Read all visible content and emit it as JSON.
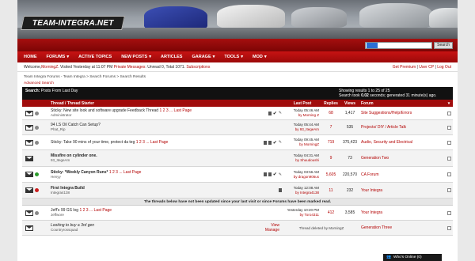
{
  "logo": {
    "text": "TEAM-INTEGRA.NET"
  },
  "search": {
    "placeholder": "",
    "button": "Search"
  },
  "nav": [
    "HOME",
    "FORUMS",
    "ACTIVE TOPICS",
    "NEW POSTS",
    "ARTICLES",
    "GARAGE",
    "TOOLS",
    "MOD"
  ],
  "userbar": {
    "welcome": "Welcome, ",
    "user": "MorningZ",
    "visited": ". Visited Yesterday at 11:07 PM",
    "pm": "Private Messages",
    "pm_counts": ": Unread 0, Total 1071.",
    "subs": "Subscriptions",
    "right": [
      "Get Premium",
      "User CP",
      "Log Out"
    ]
  },
  "breadcrumb": "Team Integra Forums - Team Integra > Search Forums > Search Results",
  "adv_search": "Advanced Search",
  "results": {
    "label": "Search:",
    "query": "Posts From Last Day",
    "showing": "Showing results 1 to 25 of 25",
    "took_prefix": "Search took ",
    "took_value": "0.02",
    "took_suffix": " seconds; generated 31 minute(s) ago."
  },
  "columns": {
    "title": "Thread / Thread Starter",
    "last": "Last Post",
    "replies": "Replies",
    "views": "Views",
    "forum": "Forum"
  },
  "rows": [
    {
      "title": "Sticky: New site look and software upgrade Feedback Thread",
      "pages": "1 2 3 ... Last Page",
      "starter": "Administrator",
      "last_time": "Today 05:46 AM",
      "last_by": "by Morning Z",
      "replies": "68",
      "views": "1,417",
      "forum": "Site Suggestions/Help/Errors",
      "style": "normal"
    },
    {
      "title": "94 LS Oil Catch Can Setup?",
      "pages": "",
      "starter": "Phat_Rip",
      "last_time": "Today 05:44 AM",
      "last_by": "by 93_ItegeAm",
      "replies": "7",
      "views": "535",
      "forum": "Projects/ DIY / Article Talk",
      "style": "normal"
    },
    {
      "title": "Sticky: Take 90 mins of your time, protect da teg",
      "pages": "1 2 3 ... Last Page",
      "starter": "",
      "last_time": "Today 09:45 AM",
      "last_by": "by MorningZ",
      "replies": "719",
      "views": "375,423",
      "forum": "Audio, Security and Electrical",
      "style": "normal"
    },
    {
      "title": "Missfire on cylinder one.",
      "pages": "",
      "starter": "93_ItegeAm",
      "last_time": "Today 04:31 AM",
      "last_by": "by Shuudoushi",
      "replies": "9",
      "views": "73",
      "forum": "Generation Two",
      "style": "bold"
    },
    {
      "title": "Sticky: *Weekly Canyon Runs*",
      "pages": "1 2 3 ... Last Page",
      "starter": "Henyy",
      "last_time": "Today 03:56 AM",
      "last_by": "by dragon906us",
      "replies": "5,605",
      "views": "220,570",
      "forum": "CA Forum",
      "style": "bold"
    },
    {
      "title": "First Integra Build",
      "pages": "",
      "starter": "Integra4138",
      "last_time": "Today 12:08 AM",
      "last_by": "by Integra4138",
      "replies": "11",
      "views": "232",
      "forum": "Your Integra",
      "style": "bold"
    }
  ],
  "notice": "The threads below have not been updated since your last visit or since Forums have been marked read.",
  "rows_after": [
    {
      "title": "Jeff's 99 GS log",
      "pages": "1 2 3 ... Last Page",
      "starter": "Jeffwore",
      "last_time": "Yesterday 10:20 PM",
      "last_by": "by Toro4311",
      "replies": "412",
      "views": "3,585",
      "forum": "Your Integra",
      "style": "normal"
    },
    {
      "title": "Looking to buy a 3rd gen",
      "pages": "",
      "starter": "Countryrossquad",
      "deleted": "Thread deleted by MorningZ",
      "view": "View",
      "manage": "Manage",
      "forum": "Generation Three",
      "style": "italic"
    }
  ],
  "whos_online": "Who's Online (0)"
}
